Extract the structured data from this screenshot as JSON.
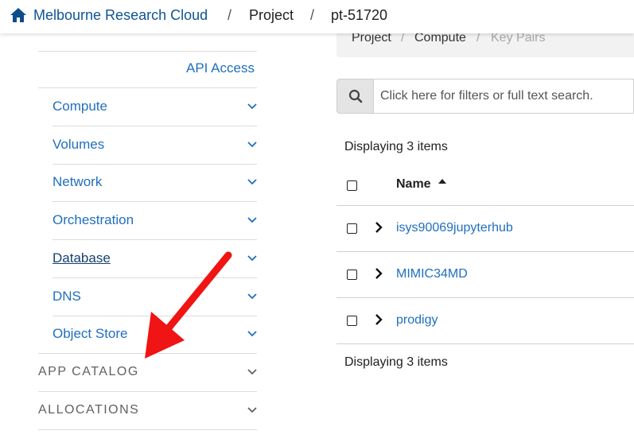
{
  "topbar": {
    "home_icon": "home-icon",
    "brand": "Melbourne Research Cloud",
    "separator": "/",
    "project": "Project",
    "project_id": "pt-51720"
  },
  "sidebar": {
    "api_access": "API Access",
    "items": [
      {
        "label": "Compute"
      },
      {
        "label": "Volumes"
      },
      {
        "label": "Network"
      },
      {
        "label": "Orchestration"
      },
      {
        "label": "Database"
      },
      {
        "label": "DNS"
      },
      {
        "label": "Object Store"
      }
    ],
    "sections": [
      {
        "label": "APP CATALOG"
      },
      {
        "label": "ALLOCATIONS"
      }
    ]
  },
  "breadcrumb": {
    "items": [
      "Project",
      "Compute",
      "Key Pairs"
    ],
    "separator": "/"
  },
  "search": {
    "placeholder": "Click here for filters or full text search."
  },
  "table": {
    "count_top": "Displaying 3 items",
    "count_bottom": "Displaying 3 items",
    "header_name": "Name",
    "rows": [
      {
        "name": "isys90069jupyterhub"
      },
      {
        "name": "MIMIC34MD"
      },
      {
        "name": "prodigy"
      }
    ]
  },
  "annotation": {
    "arrow_color": "#f01414"
  }
}
